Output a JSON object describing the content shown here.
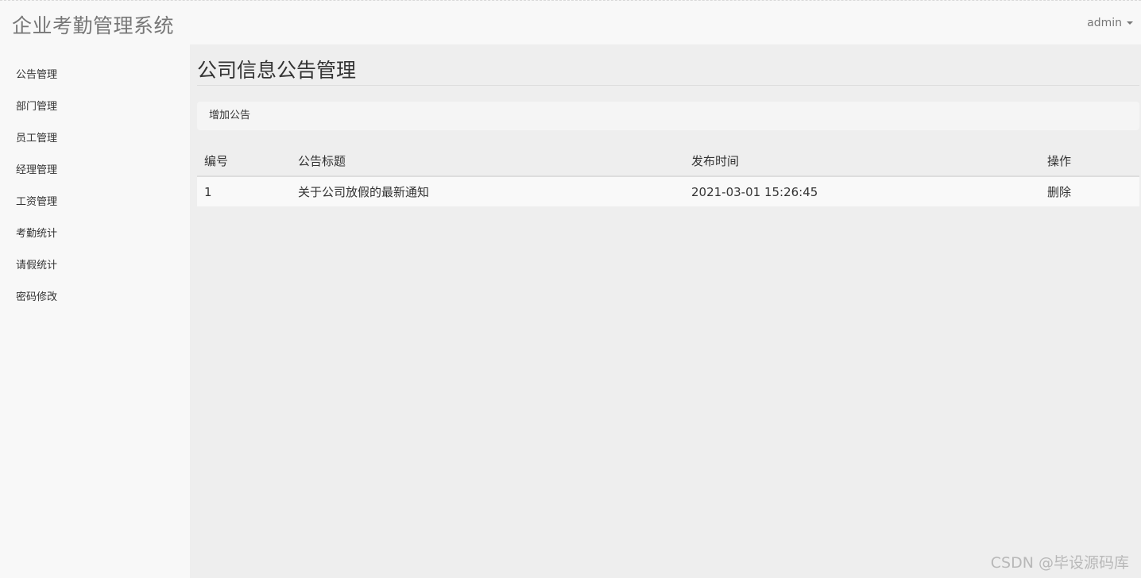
{
  "header": {
    "brand": "企业考勤管理系统",
    "user": "admin"
  },
  "sidebar": {
    "items": [
      {
        "label": "公告管理"
      },
      {
        "label": "部门管理"
      },
      {
        "label": "员工管理"
      },
      {
        "label": "经理管理"
      },
      {
        "label": "工资管理"
      },
      {
        "label": "考勤统计"
      },
      {
        "label": "请假统计"
      },
      {
        "label": "密码修改"
      }
    ]
  },
  "main": {
    "title": "公司信息公告管理",
    "add_label": "增加公告",
    "table": {
      "columns": [
        "编号",
        "公告标题",
        "发布时间",
        "操作"
      ],
      "rows": [
        {
          "id": "1",
          "title": "关于公司放假的最新通知",
          "time": "2021-03-01 15:26:45",
          "action": "删除"
        }
      ]
    }
  },
  "watermark": "CSDN @毕设源码库"
}
